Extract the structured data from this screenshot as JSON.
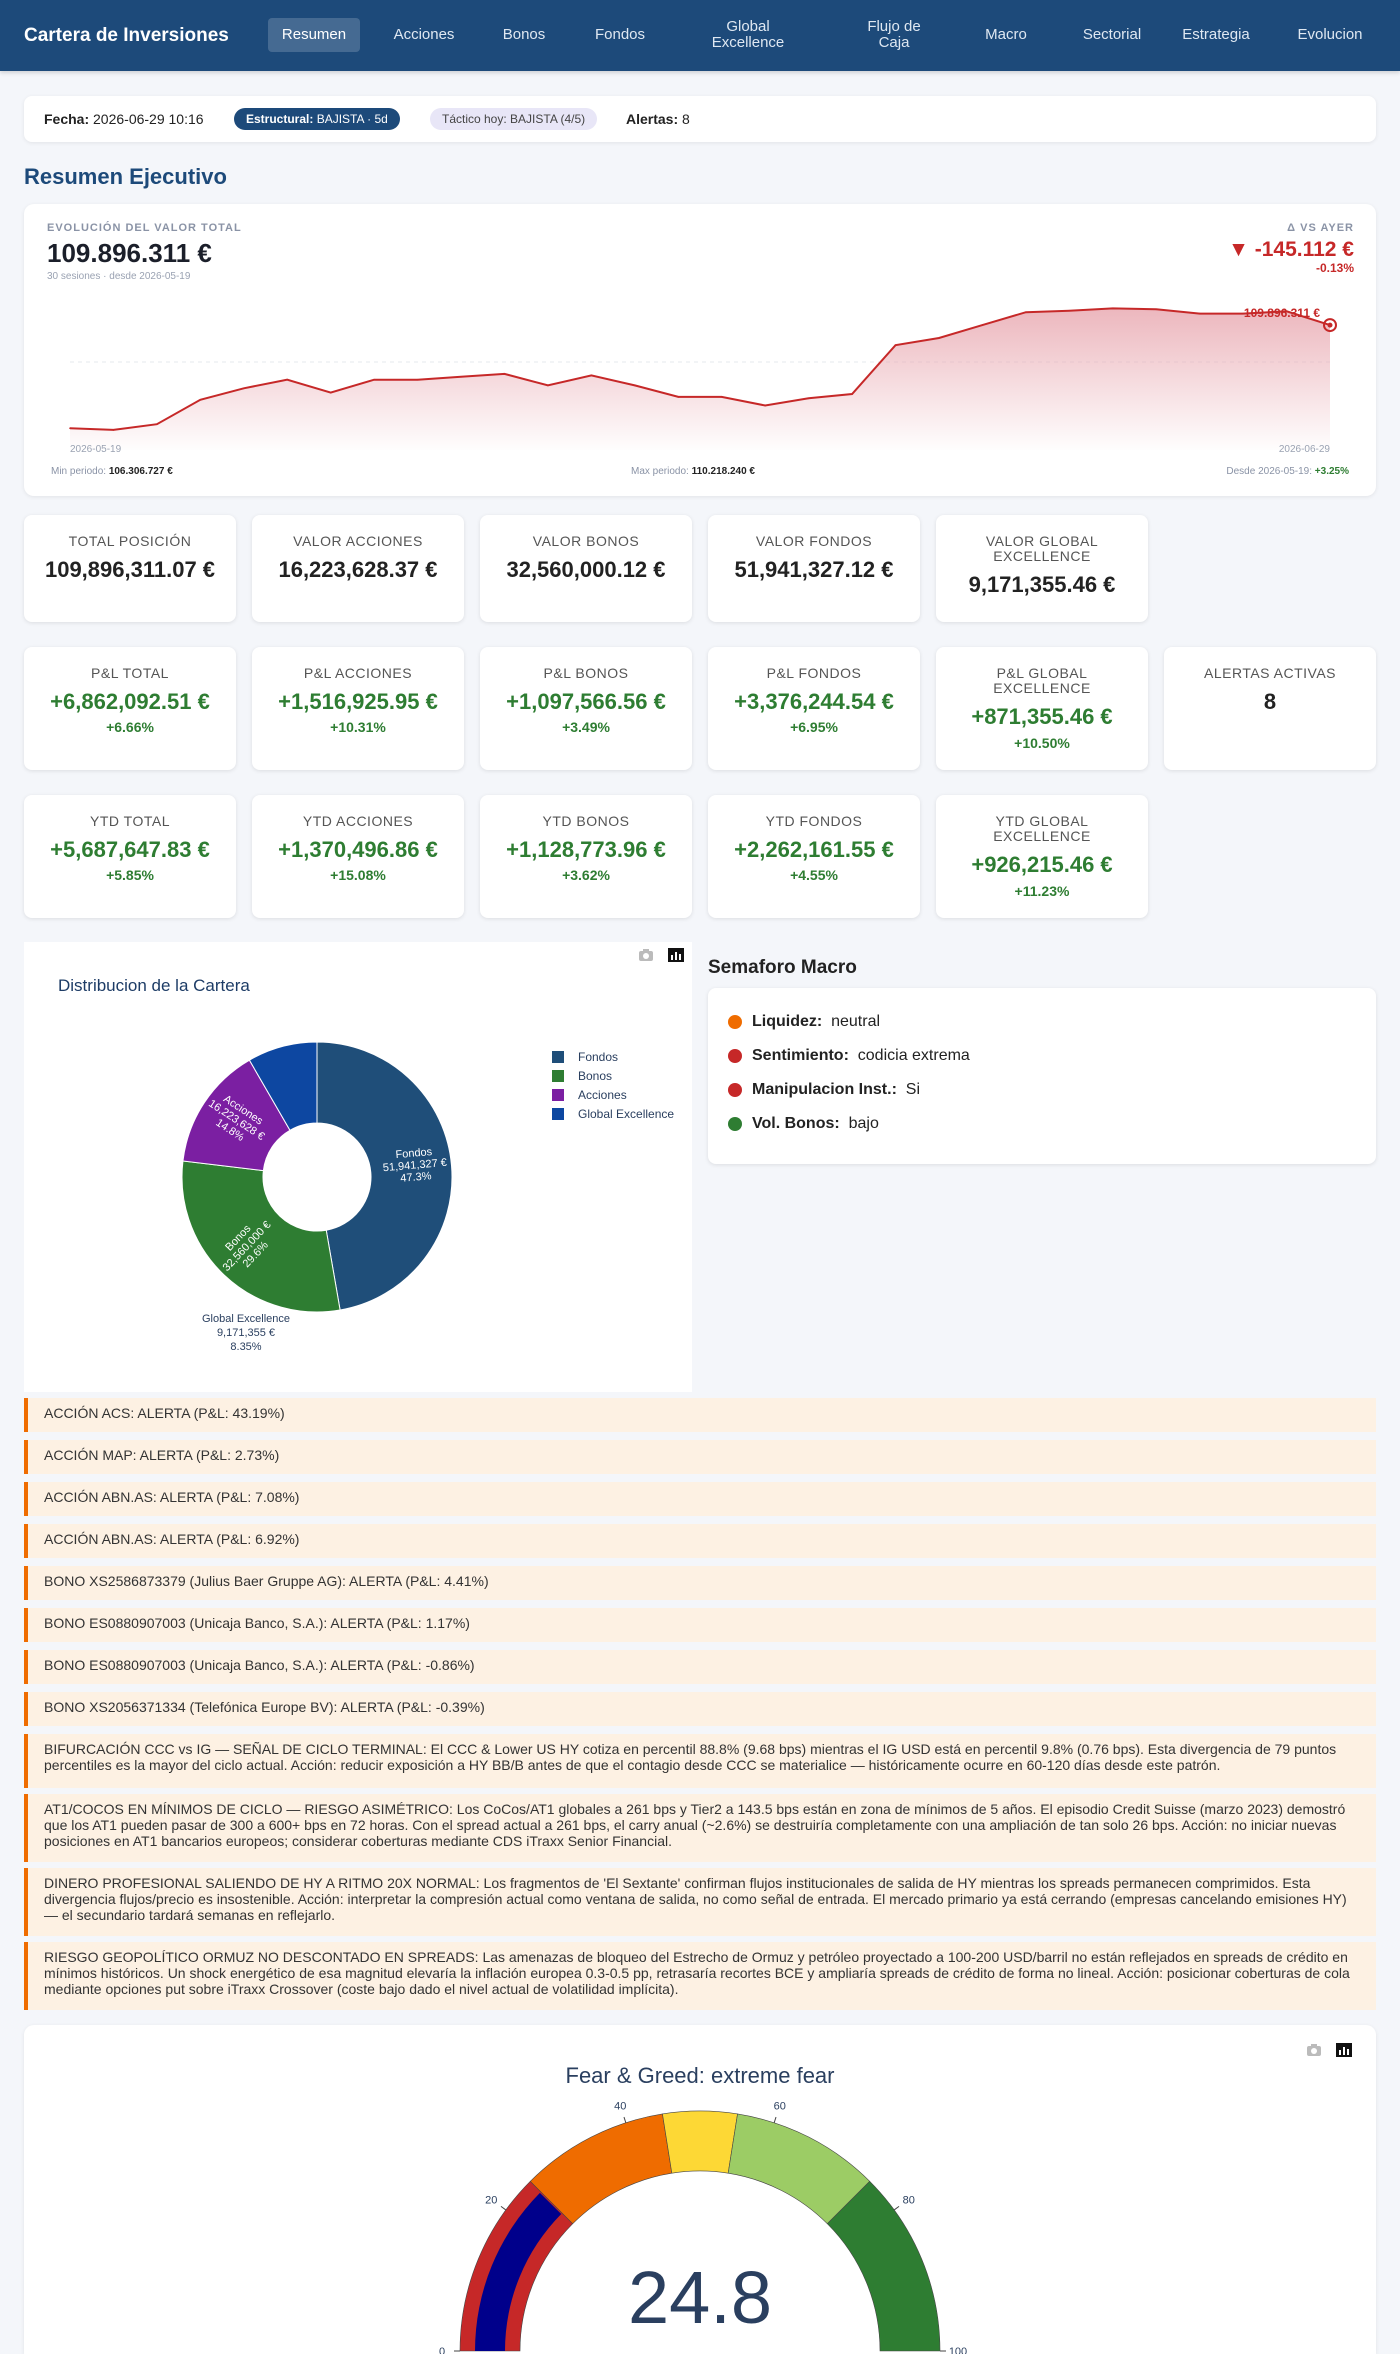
{
  "nav": {
    "brand": "Cartera de Inversiones",
    "items": [
      {
        "label": "Resumen"
      },
      {
        "label": "Acciones"
      },
      {
        "label": "Bonos"
      },
      {
        "label": "Fondos"
      },
      {
        "label": "Global Excellence"
      },
      {
        "label": "Flujo de Caja"
      },
      {
        "label": "Macro"
      },
      {
        "label": "Sectorial"
      },
      {
        "label": "Estrategia"
      },
      {
        "label": "Evolucion"
      }
    ]
  },
  "status": {
    "fecha_label": "Fecha:",
    "fecha_value": "2026-06-29 10:16",
    "estructural_label": "Estructural:",
    "estructural_value": "BAJISTA · 5d",
    "tactico": "Táctico hoy: BAJISTA (4/5)",
    "alertas_label": "Alertas:",
    "alertas_value": "8"
  },
  "resumen": {
    "title": "Resumen Ejecutivo",
    "evo": {
      "label": "EVOLUCIÓN DEL VALOR TOTAL",
      "value": "109.896.311 €",
      "sub": "30 sesiones · desde 2026-05-19",
      "delta_label": "Δ VS AYER",
      "delta_value": "▼ -145.112 €",
      "delta_pct": "-0.13%",
      "last_label": "109.896.311 €",
      "start_date": "2026-05-19",
      "end_date": "2026-06-29",
      "min_label": "Min periodo:",
      "min_value": "106.306.727 €",
      "max_label": "Max periodo:",
      "max_value": "110.218.240 €",
      "since_label": "Desde 2026-05-19:",
      "since_value": "+3.25%",
      "series": [
        106.31,
        106.25,
        106.45,
        107.3,
        107.7,
        108.0,
        107.55,
        108.0,
        108.0,
        108.1,
        108.2,
        107.8,
        108.15,
        107.8,
        107.4,
        107.4,
        107.1,
        107.35,
        107.5,
        109.2,
        109.45,
        109.9,
        110.35,
        110.4,
        110.48,
        110.45,
        110.3,
        110.3,
        110.38,
        109.9
      ],
      "y_range": [
        105.9,
        111.4
      ],
      "colors": {
        "line": "#c62828",
        "fill": "#e9aab2"
      }
    }
  },
  "kpis": {
    "row1": [
      {
        "label": "TOTAL POSICIÓN",
        "value": "109,896,311.07 €"
      },
      {
        "label": "VALOR ACCIONES",
        "value": "16,223,628.37 €"
      },
      {
        "label": "VALOR BONOS",
        "value": "32,560,000.12 €"
      },
      {
        "label": "VALOR FONDOS",
        "value": "51,941,327.12 €"
      },
      {
        "label": "VALOR GLOBAL EXCELLENCE",
        "value": "9,171,355.46 €"
      }
    ],
    "row2": [
      {
        "label": "P&L TOTAL",
        "value": "+6,862,092.51 €",
        "pct": "+6.66%"
      },
      {
        "label": "P&L ACCIONES",
        "value": "+1,516,925.95 €",
        "pct": "+10.31%"
      },
      {
        "label": "P&L BONOS",
        "value": "+1,097,566.56 €",
        "pct": "+3.49%"
      },
      {
        "label": "P&L FONDOS",
        "value": "+3,376,244.54 €",
        "pct": "+6.95%"
      },
      {
        "label": "P&L GLOBAL EXCELLENCE",
        "value": "+871,355.46 €",
        "pct": "+10.50%"
      },
      {
        "label": "ALERTAS ACTIVAS",
        "value": "8"
      }
    ],
    "row3": [
      {
        "label": "YTD TOTAL",
        "value": "+5,687,647.83 €",
        "pct": "+5.85%"
      },
      {
        "label": "YTD ACCIONES",
        "value": "+1,370,496.86 €",
        "pct": "+15.08%"
      },
      {
        "label": "YTD BONOS",
        "value": "+1,128,773.96 €",
        "pct": "+3.62%"
      },
      {
        "label": "YTD FONDOS",
        "value": "+2,262,161.55 €",
        "pct": "+4.55%"
      },
      {
        "label": "YTD GLOBAL EXCELLENCE",
        "value": "+926,215.46 €",
        "pct": "+11.23%"
      }
    ]
  },
  "chart_data": [
    {
      "type": "pie",
      "title": "Distribucion de la Cartera",
      "hole": true,
      "slices": [
        {
          "name": "Fondos",
          "value": 51941327,
          "label": "51,941,327 €",
          "pct": "47.3%",
          "color": "#1f4e79"
        },
        {
          "name": "Bonos",
          "value": 32560000,
          "label": "32,560,000 €",
          "pct": "29.6%",
          "color": "#2e7d32"
        },
        {
          "name": "Acciones",
          "value": 16223628,
          "label": "16,223,628 €",
          "pct": "14.8%",
          "color": "#7b1fa2"
        },
        {
          "name": "Global Excellence",
          "value": 9171355,
          "label": "9,171,355 €",
          "pct": "8.35%",
          "color": "#0d47a1"
        }
      ],
      "legend": [
        "Fondos",
        "Bonos",
        "Acciones",
        "Global Excellence"
      ],
      "legend_placement": "right"
    },
    {
      "type": "gauge",
      "title": "Fear & Greed: extreme fear",
      "value": 24.8,
      "range": [
        0,
        100
      ],
      "ticks": [
        "0",
        "20",
        "40",
        "60",
        "80",
        "100"
      ],
      "bands": [
        {
          "from": 0,
          "to": 25,
          "color": "#c62828"
        },
        {
          "from": 25,
          "to": 45,
          "color": "#ef6c00"
        },
        {
          "from": 45,
          "to": 55,
          "color": "#fdd835"
        },
        {
          "from": 55,
          "to": 75,
          "color": "#9ccc65"
        },
        {
          "from": 75,
          "to": 100,
          "color": "#2e7d32"
        }
      ],
      "bar_color": "#00008b"
    }
  ],
  "semaforo": {
    "title": "Semaforo Macro",
    "rows": [
      {
        "label": "Liquidez:",
        "value": "neutral",
        "color": "#ef6c00"
      },
      {
        "label": "Sentimiento:",
        "value": "codicia extrema",
        "color": "#c62828"
      },
      {
        "label": "Manipulacion Inst.:",
        "value": "Si",
        "color": "#c62828"
      },
      {
        "label": "Vol. Bonos:",
        "value": "bajo",
        "color": "#2e7d32"
      }
    ]
  },
  "alerts": [
    "ACCIÓN ACS: ALERTA (P&L: 43.19%)",
    "ACCIÓN MAP: ALERTA (P&L: 2.73%)",
    "ACCIÓN ABN.AS: ALERTA (P&L: 7.08%)",
    "ACCIÓN ABN.AS: ALERTA (P&L: 6.92%)",
    "BONO XS2586873379 (Julius Baer Gruppe AG): ALERTA (P&L: 4.41%)",
    "BONO ES0880907003 (Unicaja Banco, S.A.): ALERTA (P&L: 1.17%)",
    "BONO ES0880907003 (Unicaja Banco, S.A.): ALERTA (P&L: -0.86%)",
    "BONO XS2056371334 (Telefónica Europe BV): ALERTA (P&L: -0.39%)",
    "BIFURCACIÓN CCC vs IG — SEÑAL DE CICLO TERMINAL: El CCC & Lower US HY cotiza en percentil 88.8% (9.68 bps) mientras el IG USD está en percentil 9.8% (0.76 bps). Esta divergencia de 79 puntos percentiles es la mayor del ciclo actual. Acción: reducir exposición a HY BB/B antes de que el contagio desde CCC se materialice — históricamente ocurre en 60-120 días desde este patrón.",
    "AT1/COCOS EN MÍNIMOS DE CICLO — RIESGO ASIMÉTRICO: Los CoCos/AT1 globales a 261 bps y Tier2 a 143.5 bps están en zona de mínimos de 5 años. El episodio Credit Suisse (marzo 2023) demostró que los AT1 pueden pasar de 300 a 600+ bps en 72 horas. Con el spread actual a 261 bps, el carry anual (~2.6%) se destruiría completamente con una ampliación de tan solo 26 bps. Acción: no iniciar nuevas posiciones en AT1 bancarios europeos; considerar coberturas mediante CDS iTraxx Senior Financial.",
    "DINERO PROFESIONAL SALIENDO DE HY A RITMO 20X NORMAL: Los fragmentos de 'El Sextante' confirman flujos institucionales de salida de HY mientras los spreads permanecen comprimidos. Esta divergencia flujos/precio es insostenible. Acción: interpretar la compresión actual como ventana de salida, no como señal de entrada. El mercado primario ya está cerrando (empresas cancelando emisiones HY) — el secundario tardará semanas en reflejarlo.",
    "RIESGO GEOPOLÍTICO ORMUZ NO DESCONTADO EN SPREADS: Las amenazas de bloqueo del Estrecho de Ormuz y petróleo proyectado a 100-200 USD/barril no están reflejados en spreads de crédito en mínimos históricos. Un shock energético de esa magnitud elevaría la inflación europea 0.3-0.5 pp, retrasaría recortes BCE y ampliaría spreads de crédito de forma no lineal. Acción: posicionar coberturas de cola mediante opciones put sobre iTraxx Crossover (coste bajo dado el nivel actual de volatilidad implícita)."
  ],
  "icons": {
    "camera": "camera-icon",
    "chart": "bar-chart-icon"
  }
}
